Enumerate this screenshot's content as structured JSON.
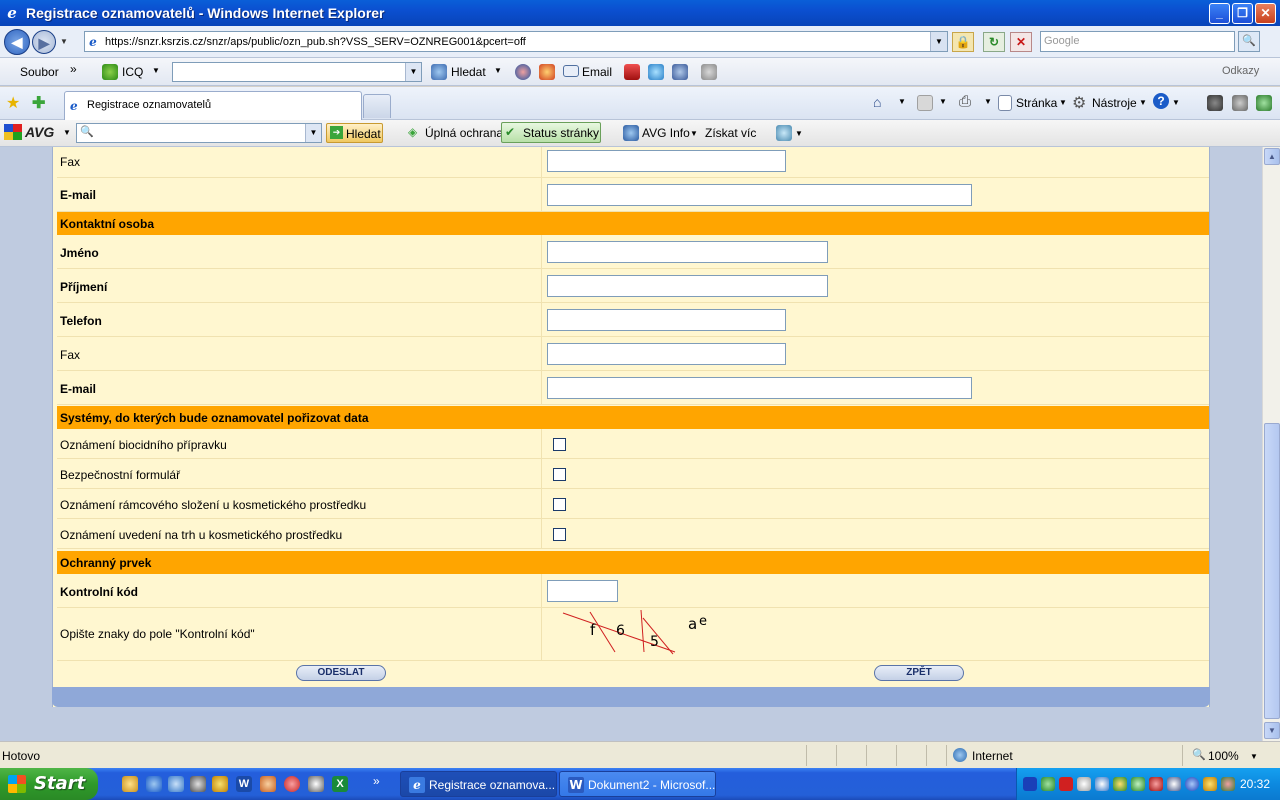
{
  "window": {
    "title": "Registrace oznamovatelů - Windows Internet Explorer"
  },
  "address": {
    "url": "https://snzr.ksrzis.cz/snzr/aps/public/ozn_pub.sh?VSS_SERV=OZNREG001&pcert=off",
    "search_placeholder": "Google"
  },
  "menubar": {
    "soubor": "Soubor",
    "chevron": "»",
    "icq": "ICQ",
    "hledat": "Hledat",
    "email": "Email",
    "odkazy": "Odkazy"
  },
  "tabs": [
    {
      "label": "Registrace oznamovatelů"
    }
  ],
  "commandbar": {
    "stranka": "Stránka",
    "nastroje": "Nástroje"
  },
  "avg": {
    "brand": "AVG",
    "search_btn": "Hledat",
    "full": "Úplná ochrana",
    "status": "Status stránky",
    "info": "AVG Info",
    "more": "Získat víc"
  },
  "form": {
    "fax1": "Fax",
    "email1": "E-mail",
    "contact_section": "Kontaktní osoba",
    "jmeno": "Jméno",
    "prijmeni": "Příjmení",
    "telefon": "Telefon",
    "fax2": "Fax",
    "email2": "E-mail",
    "systems_section": "Systémy, do kterých bude oznamovatel pořizovat data",
    "systems": [
      {
        "label": "Oznámení biocidního přípravku",
        "checked": false
      },
      {
        "label": "Bezpečnostní formulář",
        "checked": false
      },
      {
        "label": "Oznámení rámcového složení u kosmetického prostředku",
        "checked": false
      },
      {
        "label": "Oznámení uvedení na trh u kosmetického prostředku",
        "checked": false
      }
    ],
    "security_section": "Ochranný prvek",
    "kontrolni_kod": "Kontrolní kód",
    "hint": "Opište znaky do pole \"Kontrolní kód\"",
    "captcha_chars": [
      "f",
      "6",
      "5",
      "a",
      "e"
    ],
    "submit": "ODESLAT",
    "back": "ZPĚT"
  },
  "status": {
    "text": "Hotovo",
    "zone": "Internet",
    "zoom": "100%"
  },
  "taskbar": {
    "start": "Start",
    "chevron": "»",
    "tasks": [
      {
        "label": "Registrace oznamova..."
      },
      {
        "label": "Dokument2 - Microsof..."
      }
    ],
    "clock": "20:32"
  }
}
